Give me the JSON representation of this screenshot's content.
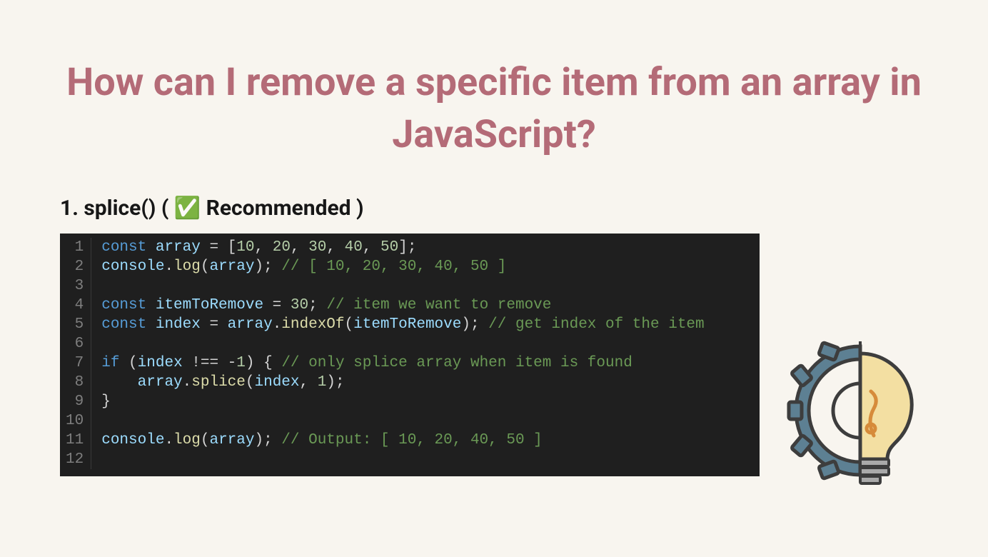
{
  "title": "How can I remove a specific item from an array in JavaScript?",
  "subhead": "1. splice() ( ✅ Recommended )",
  "code": {
    "line_count": 12,
    "lines": [
      {
        "n": 1,
        "tokens": [
          {
            "c": "kw",
            "t": "const"
          },
          {
            "c": "op",
            "t": " "
          },
          {
            "c": "var",
            "t": "array"
          },
          {
            "c": "op",
            "t": " = ["
          },
          {
            "c": "num",
            "t": "10"
          },
          {
            "c": "op",
            "t": ", "
          },
          {
            "c": "num",
            "t": "20"
          },
          {
            "c": "op",
            "t": ", "
          },
          {
            "c": "num",
            "t": "30"
          },
          {
            "c": "op",
            "t": ", "
          },
          {
            "c": "num",
            "t": "40"
          },
          {
            "c": "op",
            "t": ", "
          },
          {
            "c": "num",
            "t": "50"
          },
          {
            "c": "op",
            "t": "];"
          }
        ]
      },
      {
        "n": 2,
        "tokens": [
          {
            "c": "var",
            "t": "console"
          },
          {
            "c": "op",
            "t": "."
          },
          {
            "c": "fn",
            "t": "log"
          },
          {
            "c": "op",
            "t": "("
          },
          {
            "c": "var",
            "t": "array"
          },
          {
            "c": "op",
            "t": "); "
          },
          {
            "c": "cmt",
            "t": "// [ 10, 20, 30, 40, 50 ]"
          }
        ]
      },
      {
        "n": 3,
        "tokens": []
      },
      {
        "n": 4,
        "tokens": [
          {
            "c": "kw",
            "t": "const"
          },
          {
            "c": "op",
            "t": " "
          },
          {
            "c": "var",
            "t": "itemToRemove"
          },
          {
            "c": "op",
            "t": " = "
          },
          {
            "c": "num",
            "t": "30"
          },
          {
            "c": "op",
            "t": "; "
          },
          {
            "c": "cmt",
            "t": "// item we want to remove"
          }
        ]
      },
      {
        "n": 5,
        "tokens": [
          {
            "c": "kw",
            "t": "const"
          },
          {
            "c": "op",
            "t": " "
          },
          {
            "c": "var",
            "t": "index"
          },
          {
            "c": "op",
            "t": " = "
          },
          {
            "c": "var",
            "t": "array"
          },
          {
            "c": "op",
            "t": "."
          },
          {
            "c": "fn",
            "t": "indexOf"
          },
          {
            "c": "op",
            "t": "("
          },
          {
            "c": "var",
            "t": "itemToRemove"
          },
          {
            "c": "op",
            "t": "); "
          },
          {
            "c": "cmt",
            "t": "// get index of the item"
          }
        ]
      },
      {
        "n": 6,
        "tokens": []
      },
      {
        "n": 7,
        "tokens": [
          {
            "c": "kw",
            "t": "if"
          },
          {
            "c": "op",
            "t": " ("
          },
          {
            "c": "var",
            "t": "index"
          },
          {
            "c": "op",
            "t": " !== -"
          },
          {
            "c": "num",
            "t": "1"
          },
          {
            "c": "op",
            "t": ") { "
          },
          {
            "c": "cmt",
            "t": "// only splice array when item is found"
          }
        ]
      },
      {
        "n": 8,
        "tokens": [
          {
            "c": "op",
            "t": "    "
          },
          {
            "c": "var",
            "t": "array"
          },
          {
            "c": "op",
            "t": "."
          },
          {
            "c": "fn",
            "t": "splice"
          },
          {
            "c": "op",
            "t": "("
          },
          {
            "c": "var",
            "t": "index"
          },
          {
            "c": "op",
            "t": ", "
          },
          {
            "c": "num",
            "t": "1"
          },
          {
            "c": "op",
            "t": ");"
          }
        ]
      },
      {
        "n": 9,
        "tokens": [
          {
            "c": "op",
            "t": "}"
          }
        ]
      },
      {
        "n": 10,
        "tokens": []
      },
      {
        "n": 11,
        "tokens": [
          {
            "c": "var",
            "t": "console"
          },
          {
            "c": "op",
            "t": "."
          },
          {
            "c": "fn",
            "t": "log"
          },
          {
            "c": "op",
            "t": "("
          },
          {
            "c": "var",
            "t": "array"
          },
          {
            "c": "op",
            "t": "); "
          },
          {
            "c": "cmt",
            "t": "// Output: [ 10, 20, 40, 50 ]"
          }
        ]
      },
      {
        "n": 12,
        "tokens": []
      }
    ]
  }
}
